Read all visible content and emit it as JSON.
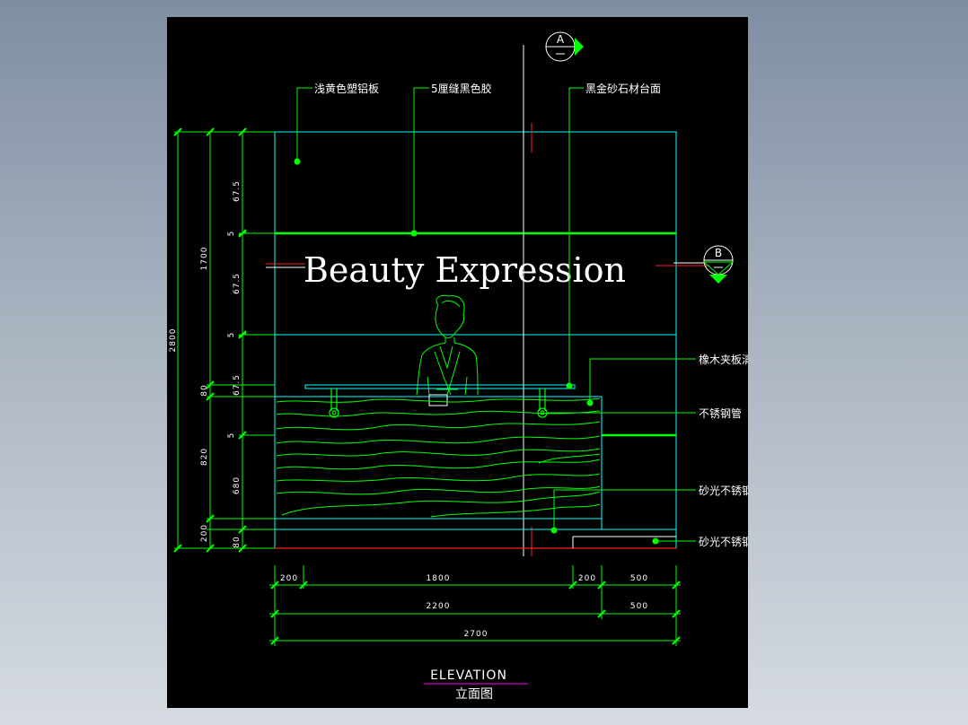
{
  "drawing": {
    "title_text": "Beauty  Expression",
    "section_marks": {
      "a": "A",
      "b": "B"
    },
    "callouts": {
      "top1": "浅黄色塑铝板",
      "top2": "5厘缝黑色胶",
      "top3": "黑金砂石材台面",
      "right1": "橡木夹板清漆",
      "right2": "不锈钢管",
      "right3": "砂光不锈钢板",
      "right4": "砂光不锈钢踢脚线"
    },
    "dims_left_inner": [
      "67.5",
      "5",
      "67.5",
      "5",
      "67.5",
      "5",
      "680",
      "80"
    ],
    "dims_left_mid": [
      "1700",
      "80",
      "820",
      "200"
    ],
    "dims_left_outer": "2800",
    "dims_bottom_row1": [
      "200",
      "1800",
      "200",
      "500"
    ],
    "dims_bottom_row2": [
      "2200",
      "500"
    ],
    "dims_bottom_row3": "2700",
    "caption_en": "ELEVATION",
    "caption_cn": "立面图"
  },
  "colors": {
    "green": "#00ff00",
    "cyan": "#00ffff",
    "red": "#ff2020",
    "magenta": "#ff00ff",
    "white": "#ffffff",
    "background": "#000000"
  }
}
